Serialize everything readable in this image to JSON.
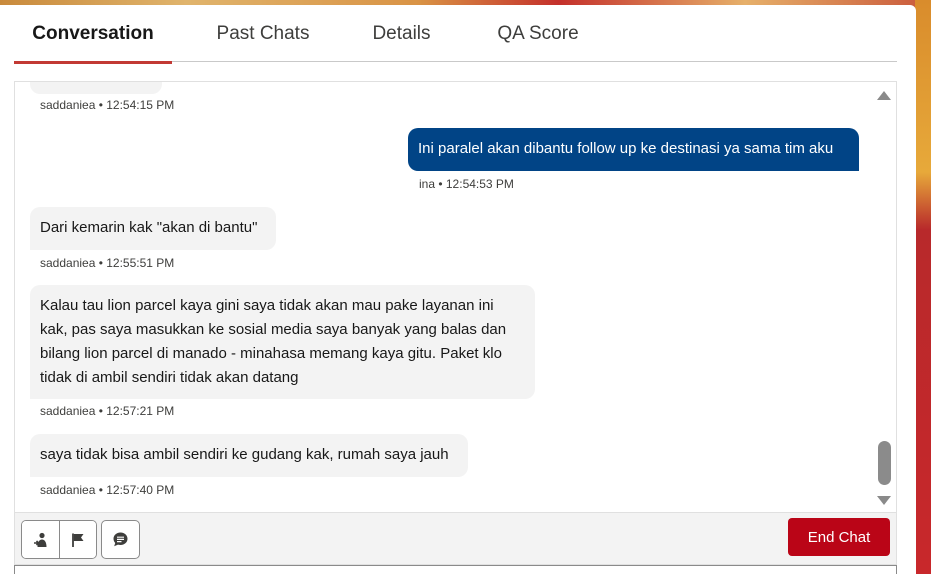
{
  "tabs": [
    {
      "label": "Conversation",
      "active": true
    },
    {
      "label": "Past Chats",
      "active": false
    },
    {
      "label": "Details",
      "active": false
    },
    {
      "label": "QA Score",
      "active": false
    }
  ],
  "messages": [
    {
      "direction": "in",
      "text": "",
      "meta": "saddaniea • 12:54:15 PM"
    },
    {
      "direction": "out",
      "text": "Ini paralel akan dibantu follow up ke destinasi ya sama tim aku",
      "meta": "ina • 12:54:53 PM"
    },
    {
      "direction": "in",
      "text": "Dari kemarin kak \"akan di bantu\"",
      "meta": "saddaniea • 12:55:51 PM"
    },
    {
      "direction": "in",
      "lines": [
        "Kalau tau lion parcel kaya gini saya tidak akan mau pake layanan ini",
        "kak, pas saya masukkan ke sosial media saya banyak yang balas dan",
        "bilang lion parcel di manado - minahasa memang kaya gitu. Paket klo",
        "tidak di ambil sendiri tidak akan datang"
      ],
      "meta": "saddaniea • 12:57:21 PM"
    },
    {
      "direction": "in",
      "text": "saya tidak bisa ambil sendiri ke gudang kak, rumah saya jauh",
      "meta": "saddaniea • 12:57:40 PM"
    }
  ],
  "toolbar": {
    "end_chat_label": "End Chat",
    "icons": [
      "transfer-icon",
      "flag-icon",
      "quick-text-icon"
    ]
  },
  "colors": {
    "accent": "#c23934",
    "outgoing_bubble": "#014486",
    "incoming_bubble": "#f3f3f3",
    "end_chat": "#ba0517"
  }
}
